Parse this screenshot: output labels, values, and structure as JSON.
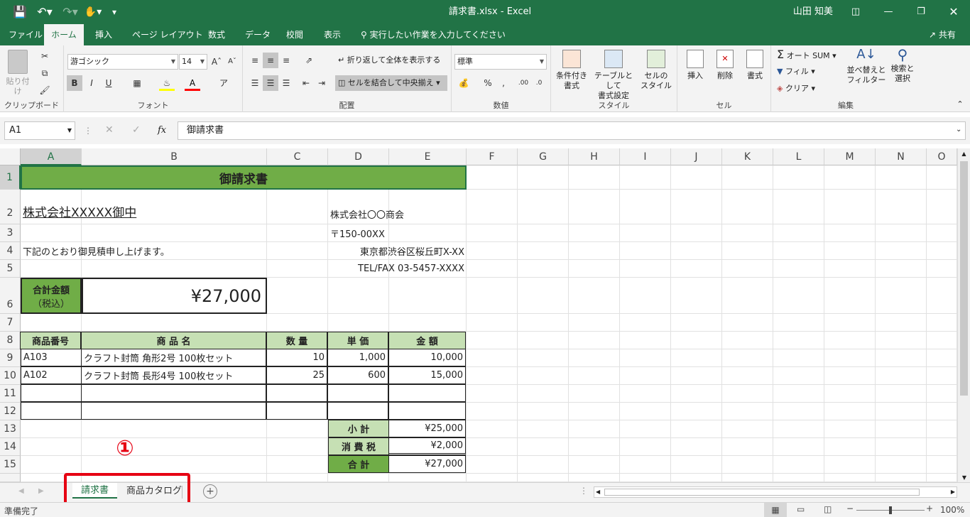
{
  "titlebar": {
    "filename": "請求書.xlsx  -  Excel",
    "user": "山田 知美"
  },
  "ribbon_tabs": [
    "ファイル",
    "ホーム",
    "挿入",
    "ページ レイアウト",
    "数式",
    "データ",
    "校閲",
    "表示"
  ],
  "tell_me": "実行したい作業を入力してください",
  "share": "共有",
  "ribbon": {
    "clipboard": {
      "paste": "貼り付け",
      "label": "クリップボード"
    },
    "font": {
      "name": "游ゴシック",
      "size": "14",
      "label": "フォント",
      "bold": "B",
      "italic": "I",
      "underline": "U"
    },
    "alignment": {
      "wrap": "折り返して全体を表示する",
      "merge": "セルを結合して中央揃え",
      "label": "配置"
    },
    "number": {
      "format": "標準",
      "label": "数値"
    },
    "styles": {
      "conditional": "条件付き",
      "conditional2": "書式",
      "table": "テーブルとして",
      "table2": "書式設定",
      "cell": "セルの",
      "cell2": "スタイル",
      "label": "スタイル"
    },
    "cells": {
      "insert": "挿入",
      "delete": "削除",
      "format": "書式",
      "label": "セル"
    },
    "editing": {
      "autosum": "オート SUM",
      "fill": "フィル",
      "clear": "クリア",
      "sort": "並べ替えと",
      "sort2": "フィルター",
      "find": "検索と",
      "find2": "選択",
      "label": "編集"
    }
  },
  "formula_bar": {
    "name_box": "A1",
    "content": "御請求書",
    "fx": "fx"
  },
  "columns": [
    "A",
    "B",
    "C",
    "D",
    "E",
    "F",
    "G",
    "H",
    "I",
    "J",
    "K",
    "L",
    "M",
    "N",
    "O"
  ],
  "rows": [
    "1",
    "2",
    "3",
    "4",
    "5",
    "6",
    "7",
    "8",
    "9",
    "10",
    "11",
    "12",
    "13",
    "14",
    "15"
  ],
  "sheet": {
    "title": "御請求書",
    "client": "株式会社XXXXX御中",
    "company": "株式会社〇〇商会",
    "zip": "〒150-00XX",
    "address": "東京都渋谷区桜丘町X-XX",
    "tel": "TEL/FAX 03-5457-XXXX",
    "intro": "下記のとおり御見積申し上げます。",
    "total_label1": "合計金額",
    "total_label2": "（税込）",
    "total_value": "¥27,000",
    "headers": [
      "商品番号",
      "商 品 名",
      "数 量",
      "単 価",
      "金 額"
    ],
    "items": [
      {
        "code": "A103",
        "name": "クラフト封筒 角形2号 100枚セット",
        "qty": "10",
        "price": "1,000",
        "amount": "10,000"
      },
      {
        "code": "A102",
        "name": "クラフト封筒 長形4号 100枚セット",
        "qty": "25",
        "price": "600",
        "amount": "15,000"
      }
    ],
    "subtotal_label": "小 計",
    "subtotal": "¥25,000",
    "tax_label": "消 費 税",
    "tax": "¥2,000",
    "grand_label": "合 計",
    "grand": "¥27,000"
  },
  "annotation": "①",
  "sheet_tabs": [
    "請求書",
    "商品カタログ"
  ],
  "status": {
    "ready": "準備完了",
    "zoom": "100%"
  },
  "colors": {
    "excel_green": "#217346",
    "header_green": "#c6e0b4",
    "dark_green": "#70ad47",
    "highlight_red": "#e60012"
  }
}
